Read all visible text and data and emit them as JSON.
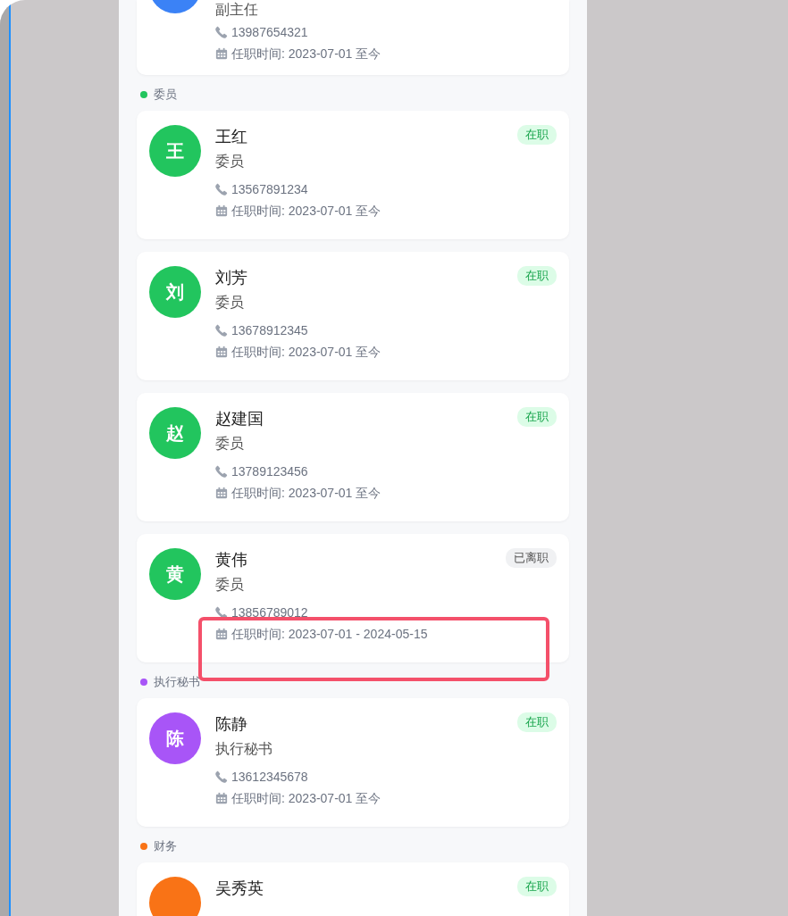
{
  "groups": [
    {
      "color": "#3b82f6",
      "members": [
        {
          "role": "副主任",
          "phone": "13987654321",
          "tenure": "任职时间: 2023-07-01 至今"
        }
      ]
    },
    {
      "label": "委员",
      "color": "#22c55e",
      "members": [
        {
          "avatar": "王",
          "name": "王红",
          "role": "委员",
          "phone": "13567891234",
          "tenure": "任职时间: 2023-07-01 至今",
          "status": {
            "text": "在职",
            "active": true
          }
        },
        {
          "avatar": "刘",
          "name": "刘芳",
          "role": "委员",
          "phone": "13678912345",
          "tenure": "任职时间: 2023-07-01 至今",
          "status": {
            "text": "在职",
            "active": true
          }
        },
        {
          "avatar": "赵",
          "name": "赵建国",
          "role": "委员",
          "phone": "13789123456",
          "tenure": "任职时间: 2023-07-01 至今",
          "status": {
            "text": "在职",
            "active": true
          }
        },
        {
          "avatar": "黄",
          "name": "黄伟",
          "role": "委员",
          "phone": "13856789012",
          "tenure": "任职时间: 2023-07-01 - 2024-05-15",
          "status": {
            "text": "已离职",
            "active": false
          },
          "highlighted": true
        }
      ]
    },
    {
      "label": "执行秘书",
      "color": "#a855f7",
      "members": [
        {
          "avatar": "陈",
          "name": "陈静",
          "role": "执行秘书",
          "phone": "13612345678",
          "tenure": "任职时间: 2023-07-01 至今",
          "status": {
            "text": "在职",
            "active": true
          }
        }
      ]
    },
    {
      "label": "财务",
      "color": "#f97316",
      "members": [
        {
          "name": "吴秀英",
          "status": {
            "text": "在职",
            "active": true
          }
        }
      ]
    }
  ]
}
